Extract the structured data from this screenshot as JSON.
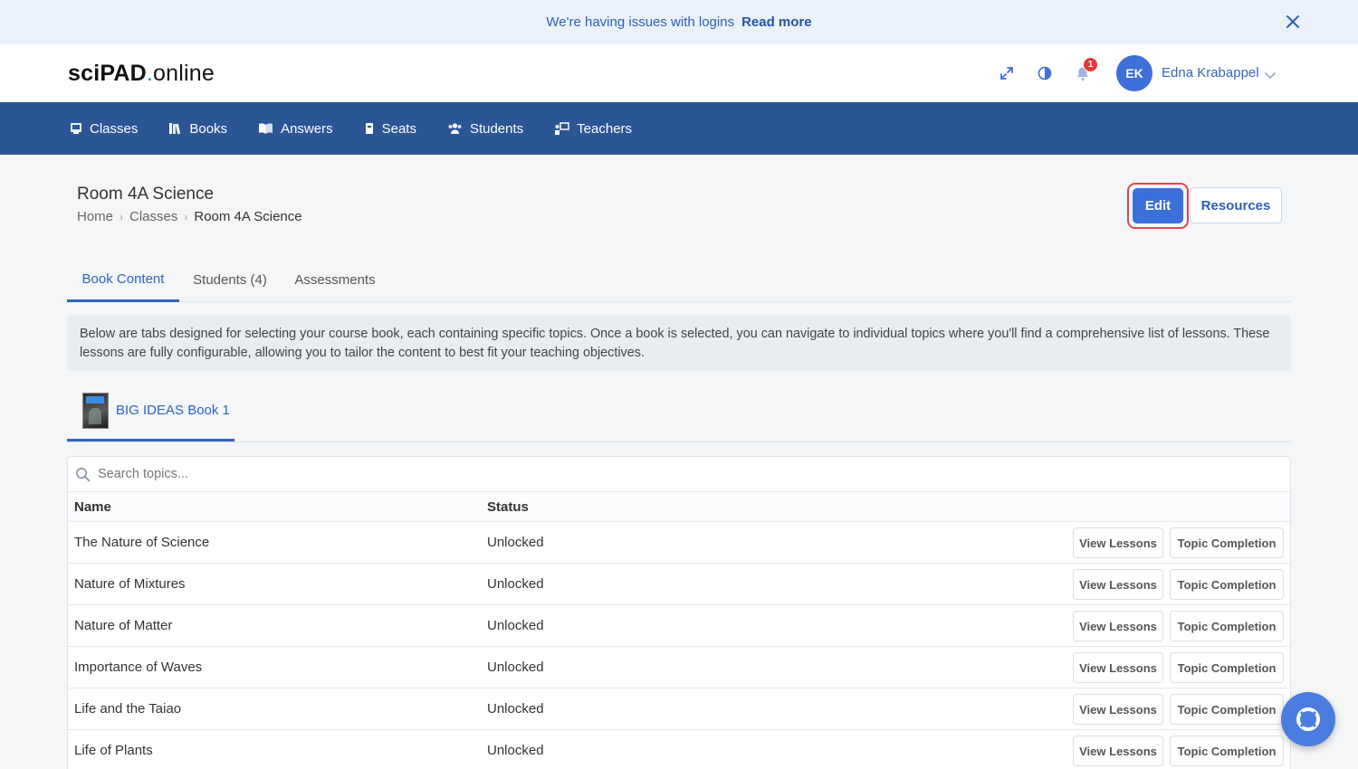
{
  "banner": {
    "message": "We're having issues with logins",
    "link": "Read more"
  },
  "header": {
    "logo_bold": "sciPAD",
    "logo_dot": ".",
    "logo_rest": "online",
    "notification_count": "1",
    "avatar_initials": "EK",
    "user_name": "Edna Krabappel"
  },
  "nav": {
    "items": [
      {
        "label": "Classes",
        "icon": "classes-icon"
      },
      {
        "label": "Books",
        "icon": "books-icon"
      },
      {
        "label": "Answers",
        "icon": "answers-icon"
      },
      {
        "label": "Seats",
        "icon": "seats-icon"
      },
      {
        "label": "Students",
        "icon": "students-icon"
      },
      {
        "label": "Teachers",
        "icon": "teachers-icon"
      }
    ]
  },
  "page": {
    "title": "Room 4A Science",
    "breadcrumb": [
      "Home",
      "Classes",
      "Room 4A Science"
    ],
    "edit_label": "Edit",
    "resources_label": "Resources"
  },
  "tabs": [
    "Book Content",
    "Students (4)",
    "Assessments"
  ],
  "info_text": "Below are tabs designed for selecting your course book, each containing specific topics. Once a book is selected, you can navigate to individual topics where you'll find a comprehensive list of lessons. These lessons are fully configurable, allowing you to tailor the content to best fit your teaching objectives.",
  "book": {
    "label": "BIG IDEAS Book 1"
  },
  "table": {
    "search_placeholder": "Search topics...",
    "columns": {
      "name": "Name",
      "status": "Status"
    },
    "view_label": "View Lessons",
    "completion_label": "Topic Completion",
    "rows": [
      {
        "name": "The Nature of Science",
        "status": "Unlocked"
      },
      {
        "name": "Nature of Mixtures",
        "status": "Unlocked"
      },
      {
        "name": "Nature of Matter",
        "status": "Unlocked"
      },
      {
        "name": "Importance of Waves",
        "status": "Unlocked"
      },
      {
        "name": "Life and the Taiao",
        "status": "Unlocked"
      },
      {
        "name": "Life of Plants",
        "status": "Unlocked"
      }
    ]
  },
  "colors": {
    "nav_bg": "#2c5596",
    "accent": "#3b6fd9",
    "banner_bg": "#eaf1fb",
    "badge": "#e53935"
  }
}
